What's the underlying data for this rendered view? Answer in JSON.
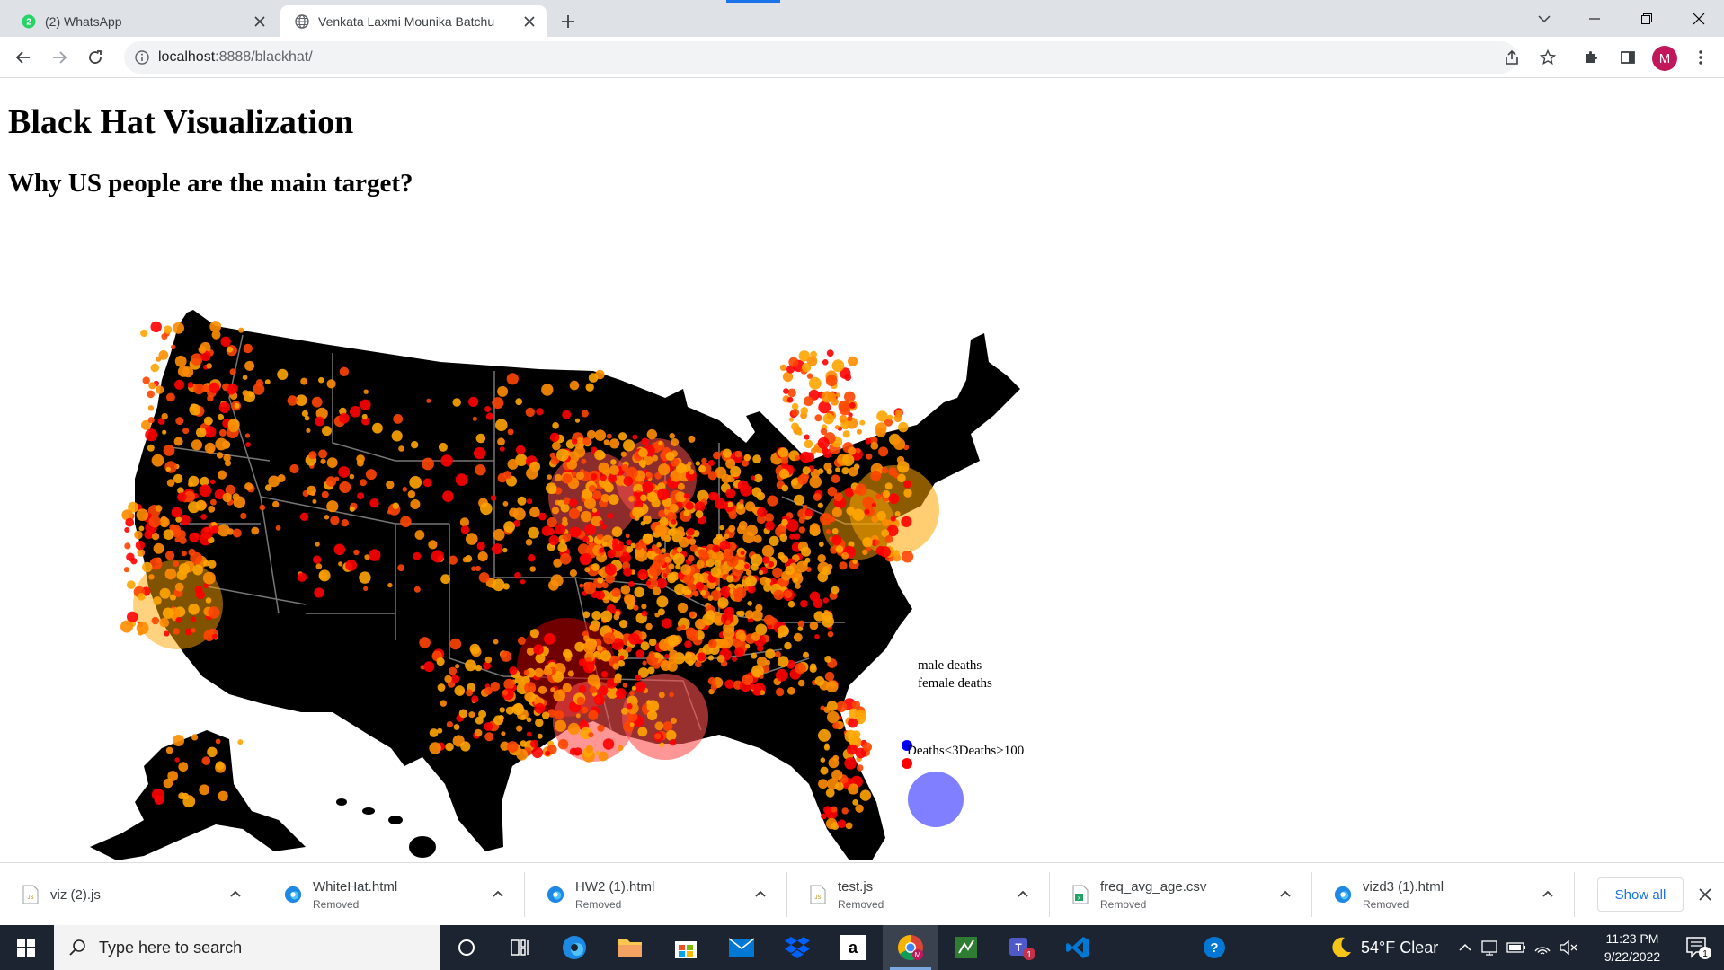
{
  "browser": {
    "tabs": [
      {
        "label": "(2) WhatsApp",
        "badge": "2",
        "active": false
      },
      {
        "label": "Venkata Laxmi Mounika Batchu",
        "active": true
      }
    ],
    "new_tab_label": "+",
    "url_host": "localhost",
    "url_rest": ":8888/blackhat/",
    "profile_initial": "M"
  },
  "page": {
    "title": "Black Hat Visualization",
    "subtitle": "Why US people are the main target?",
    "legend": {
      "male_label": "male deaths",
      "female_label": "female deaths",
      "size_label": "Deaths<3Deaths>100",
      "male_color": "#0000ff",
      "female_color": "#ff0000"
    }
  },
  "downloads": {
    "items": [
      {
        "name": "viz (2).js",
        "status": "",
        "icon": "js-file-icon"
      },
      {
        "name": "WhiteHat.html",
        "status": "Removed",
        "icon": "edge-icon"
      },
      {
        "name": "HW2 (1).html",
        "status": "Removed",
        "icon": "edge-icon"
      },
      {
        "name": "test.js",
        "status": "Removed",
        "icon": "js-file-icon"
      },
      {
        "name": "freq_avg_age.csv",
        "status": "Removed",
        "icon": "excel-icon"
      },
      {
        "name": "vizd3 (1).html",
        "status": "Removed",
        "icon": "edge-icon"
      }
    ],
    "show_all_label": "Show all"
  },
  "taskbar": {
    "search_placeholder": "Type here to search",
    "weather": "54°F  Clear",
    "time": "11:23 PM",
    "date": "9/22/2022",
    "notification_count": "1",
    "teams_badge": "1",
    "chrome_badge": "M"
  }
}
